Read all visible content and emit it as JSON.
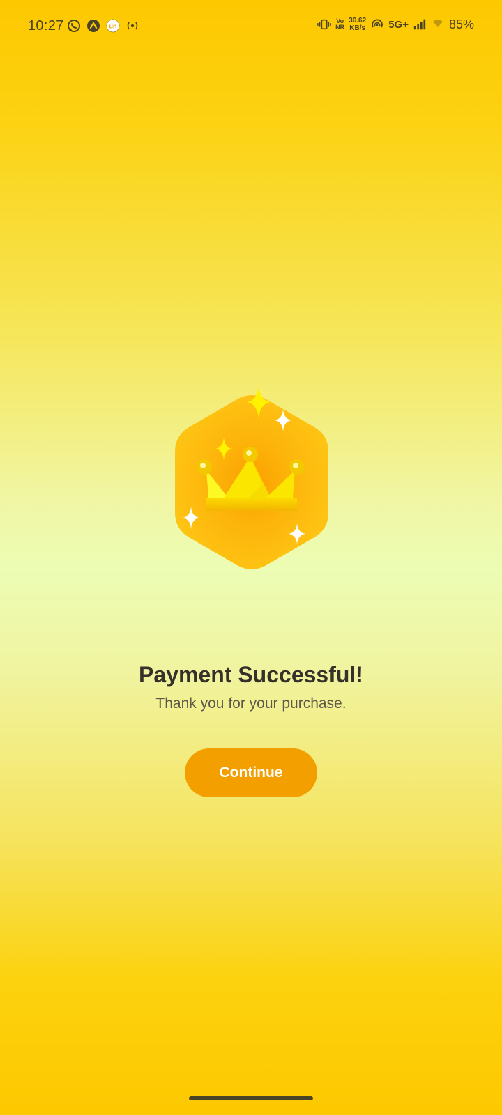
{
  "status_bar": {
    "time": "10:27",
    "left_icons": [
      "whatsapp-icon",
      "arrow-up-app-icon",
      "un-app-icon",
      "hotspot-icon"
    ],
    "volte_label": "Vo\nNR",
    "net_speed_value": "30.62",
    "net_speed_unit": "KB/s",
    "network_type": "5G+",
    "battery": "85%"
  },
  "main": {
    "title": "Payment Successful!",
    "subtitle": "Thank you for your purchase.",
    "continue_label": "Continue"
  },
  "colors": {
    "accent": "#f39f00",
    "title": "#35302a",
    "subtitle": "#5e584b"
  }
}
